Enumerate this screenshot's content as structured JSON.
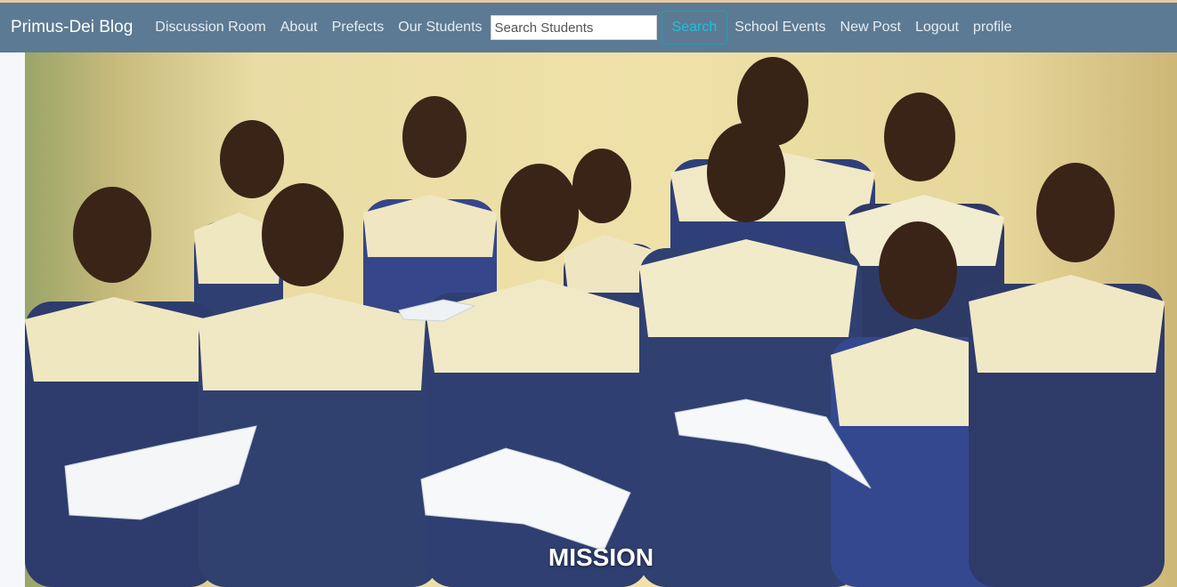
{
  "navbar": {
    "brand": "Primus-Dei Blog",
    "links_before_search": [
      "Discussion Room",
      "About",
      "Prefects",
      "Our Students"
    ],
    "search_placeholder": "Search Students",
    "search_button": "Search",
    "links_after_search": [
      "School Events",
      "New Post",
      "Logout",
      "profile"
    ]
  },
  "hero": {
    "image_alt": "Students in school uniforms holding open books",
    "caption_title": "MISSION",
    "caption_text": ""
  },
  "colors": {
    "navbar": "#5c7a93",
    "search_accent": "#17a2b8"
  }
}
